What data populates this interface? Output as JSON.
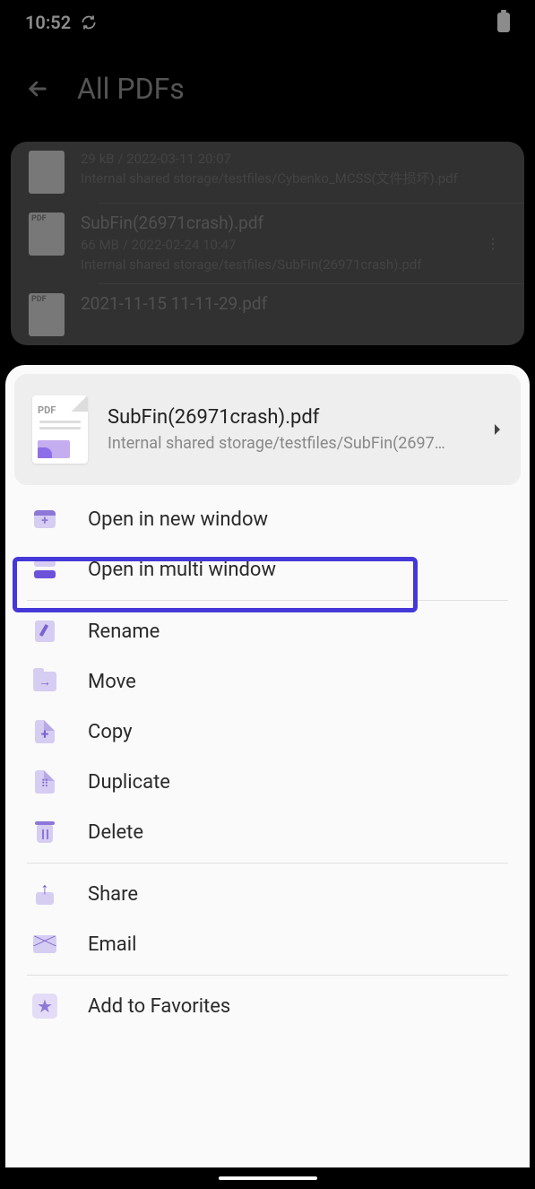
{
  "status": {
    "time": "10:52"
  },
  "header": {
    "title": "All PDFs"
  },
  "bg_items": [
    {
      "meta": "29 kB / 2022-03-11 20:07",
      "path": "Internal shared storage/testfiles/Cybenko_MCSS(文件损坏).pdf"
    },
    {
      "title": "SubFin(26971crash).pdf",
      "meta": "66 MB / 2022-02-24 10:47",
      "path": "Internal shared storage/testfiles/SubFin(26971crash).pdf"
    },
    {
      "title": "2021-11-15 11-11-29.pdf"
    }
  ],
  "sheet": {
    "title": "SubFin(26971crash).pdf",
    "path": "Internal shared storage/testfiles/SubFin(2697…"
  },
  "menu": {
    "open_new_window": "Open in new window",
    "open_multi_window": "Open in multi window",
    "rename": "Rename",
    "move": "Move",
    "copy": "Copy",
    "duplicate": "Duplicate",
    "delete": "Delete",
    "share": "Share",
    "email": "Email",
    "add_favorites": "Add to Favorites"
  }
}
